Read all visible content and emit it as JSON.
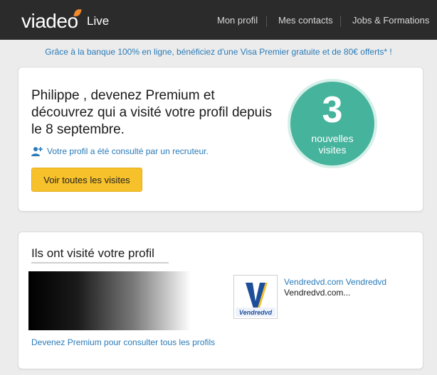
{
  "header": {
    "logo_text_a": "viade",
    "logo_text_b": "o",
    "logo_live": "Live",
    "nav": [
      "Mon profil",
      "Mes contacts",
      "Jobs & Formations"
    ]
  },
  "promo": "Grâce à la banque 100% en ligne, bénéficiez d'une Visa Premier gratuite et de 80€ offerts* !",
  "premium_card": {
    "line1": "Philippe , devenez Premium et",
    "line2": "découvrez qui a visité votre profil depuis",
    "line3": "le 8 septembre.",
    "recruiter_note": "Votre profil a été consulté par un recruteur.",
    "button_label": "Voir toutes les visites",
    "badge_number": "3",
    "badge_line1": "nouvelles",
    "badge_line2": "visites"
  },
  "visitors_card": {
    "title": "Ils ont visité votre profil",
    "premium_link": "Devenez Premium pour consulter tous les profils",
    "visitor": {
      "logo_text": "Vendredvd",
      "name": "Vendredvd.com Vendredvd",
      "subtitle": "Vendredvd.com..."
    }
  },
  "colors": {
    "topbar": "#2b2b2b",
    "accent_blue": "#2a7bb8",
    "button_yellow": "#f7c12b",
    "badge_green": "#46b39c"
  }
}
